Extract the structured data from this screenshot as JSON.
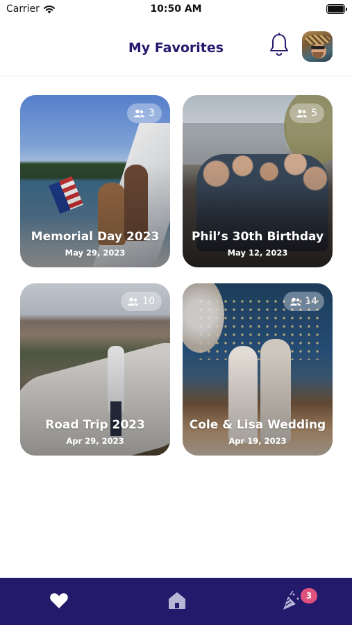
{
  "status_bar": {
    "carrier": "Carrier",
    "time": "10:50 AM"
  },
  "header": {
    "title": "My Favorites"
  },
  "albums": [
    {
      "title": "Memorial Day 2023",
      "date": "May 29, 2023",
      "people": "3"
    },
    {
      "title": "Phil’s 30th Birthday",
      "date": "May 12, 2023",
      "people": "5"
    },
    {
      "title": "Road Trip 2023",
      "date": "Apr 29, 2023",
      "people": "10"
    },
    {
      "title": "Cole & Lisa Wedding",
      "date": "Apr 19, 2023",
      "people": "14"
    }
  ],
  "tab_bar": {
    "events_count": "3"
  },
  "icons": {
    "status": [
      "wifi-icon",
      "battery-icon"
    ],
    "header": [
      "bell-icon",
      "avatar"
    ],
    "badge": "people-icon",
    "tabs": [
      "heart-icon",
      "home-icon",
      "party-popper-icon"
    ]
  },
  "colors": {
    "brand": "#231a6b",
    "title": "#241a6e",
    "notification": "#e0517d"
  }
}
